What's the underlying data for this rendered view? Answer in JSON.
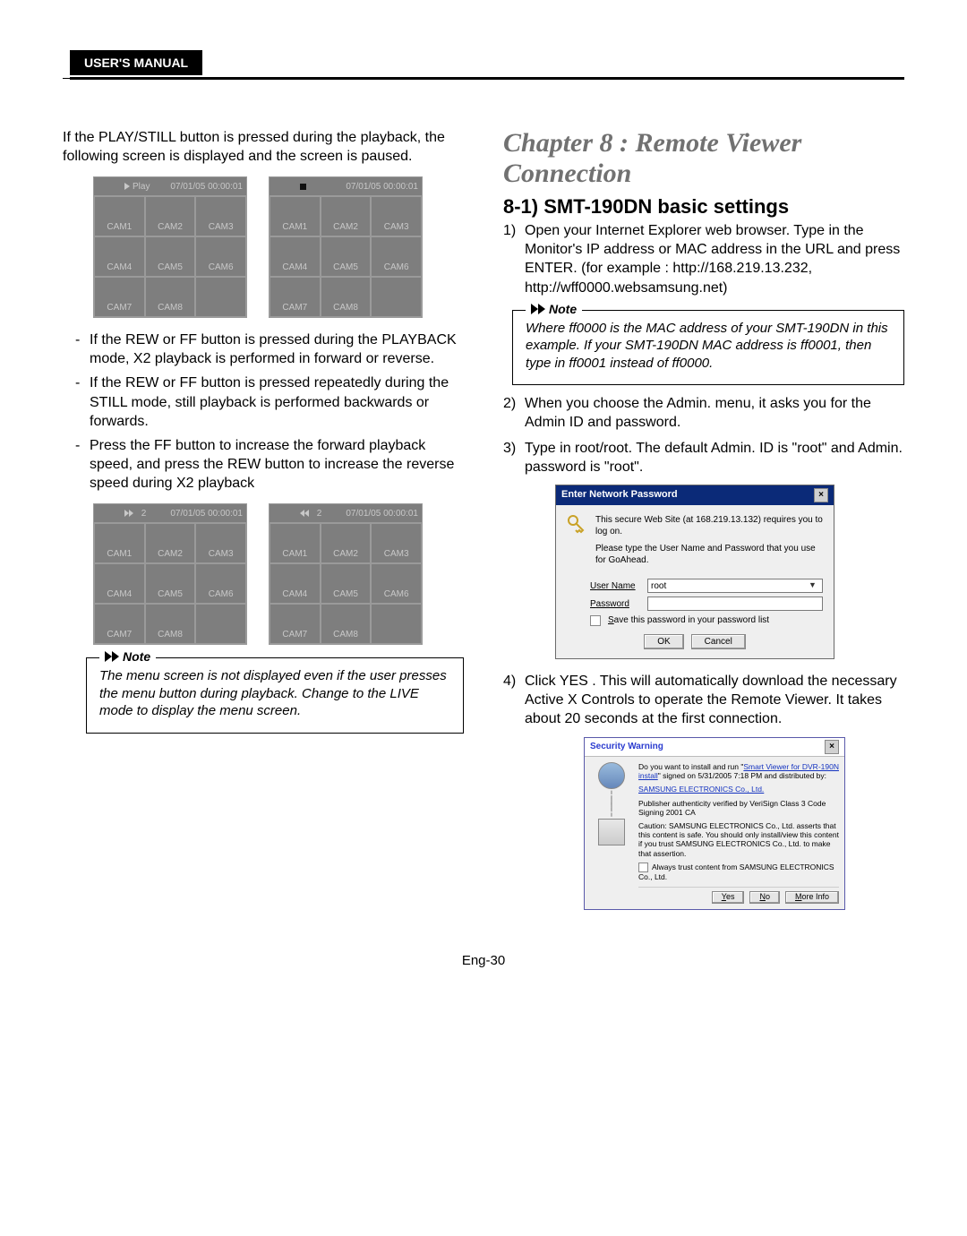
{
  "tab_label": "USER'S MANUAL",
  "left": {
    "intro": "If the PLAY/STILL button is pressed during the playback, the following screen is displayed and the screen is paused.",
    "grid_ts": "07/01/05  00:00:01",
    "play_label": "Play",
    "cams": [
      "CAM1",
      "CAM2",
      "CAM3",
      "CAM4",
      "CAM5",
      "CAM6",
      "CAM7",
      "CAM8",
      ""
    ],
    "bullets": [
      "If the REW or FF button is pressed during the PLAYBACK mode, X2 playback is performed in forward or reverse.",
      "If the REW or FF button is pressed repeatedly during the STILL mode, still playback is performed backwards or forwards.",
      "Press the FF button to increase the forward playback speed, and press the REW button to increase the reverse speed during X2 playback"
    ],
    "speed_label": "2",
    "note_label": "Note",
    "note_text": "The menu screen is not displayed even if the user presses the menu button during playback. Change to the LIVE mode to display the menu screen."
  },
  "right": {
    "chapter": "Chapter 8 : Remote Viewer Connection",
    "section": "8-1) SMT-190DN basic settings",
    "step1": "Open your Internet Explorer web browser. Type in the Monitor's IP address or MAC address in the URL and press ENTER.  (for example : http://168.219.13.232, http://wff0000.websamsung.net)",
    "note_label": "Note",
    "note_text": "Where ff0000 is the MAC address of your SMT-190DN in this example. If your SMT-190DN MAC address is ff0001, then type in ff0001 instead of ff0000.",
    "step2": "When you choose the Admin. menu, it asks you for the Admin ID and password.",
    "step3": "Type in root/root. The default Admin. ID is \"root\" and Admin. password is \"root\".",
    "dlg": {
      "title": "Enter Network Password",
      "line1": "This secure Web Site (at 168.219.13.132) requires you to log on.",
      "line2": "Please type the User Name and Password that you use for GoAhead.",
      "user_label": "User Name",
      "user_val": "root",
      "pass_label": "Password",
      "save": "Save this password in your password list",
      "ok": "OK",
      "cancel": "Cancel"
    },
    "step4": "Click YES . This will automatically download the necessary Active X Controls to operate the Remote Viewer. It takes about 20 seconds at the first connection.",
    "dlg2": {
      "title": "Security Warning",
      "l1a": "Do you want to install and run \"",
      "l1link": "Smart Viewer for DVR-190N install",
      "l1b": "\" signed on 5/31/2005 7:18 PM and distributed by:",
      "l2": "SAMSUNG ELECTRONICS Co., Ltd.",
      "l3": "Publisher authenticity verified by VeriSign Class 3 Code Signing 2001 CA",
      "l4": "Caution: SAMSUNG ELECTRONICS Co., Ltd. asserts that this content is safe.  You should only install/view this content if you trust SAMSUNG ELECTRONICS Co., Ltd. to make that assertion.",
      "l5": "Always trust content from SAMSUNG ELECTRONICS Co., Ltd.",
      "yes": "Yes",
      "no": "No",
      "more": "More Info"
    }
  },
  "footer": "Eng-30"
}
